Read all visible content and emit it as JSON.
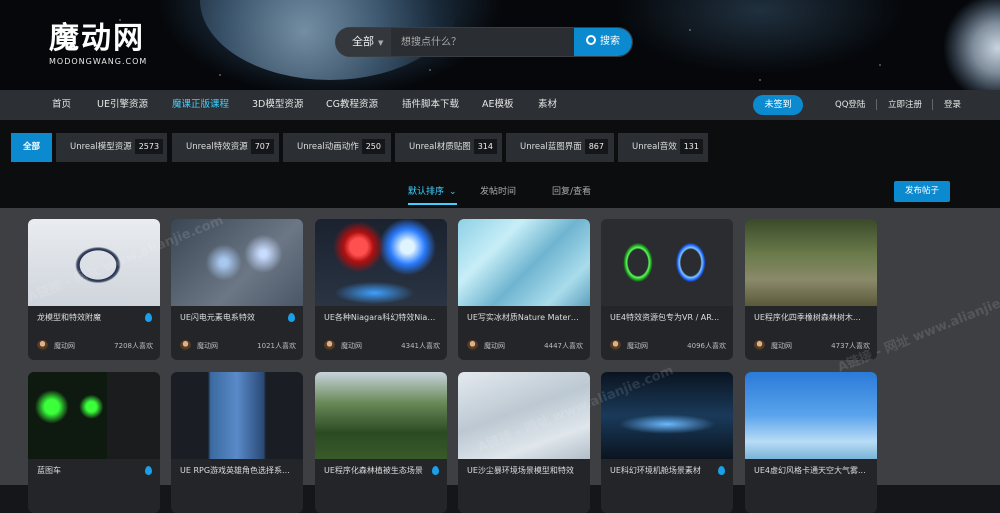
{
  "logo": {
    "main": "魔动网",
    "sub": "MODONGWANG.COM"
  },
  "search": {
    "category": "全部",
    "placeholder": "想搜点什么？",
    "button": "搜索"
  },
  "nav": {
    "items": [
      "首页",
      "UE引擎资源",
      "魔课正版课程",
      "3D模型资源",
      "CG教程资源",
      "插件脚本下载",
      "AE模板",
      "素材"
    ],
    "active_index": 2,
    "checkin": "未签到",
    "qq_login": "QQ登陆",
    "register": "立即注册",
    "login": "登录"
  },
  "categories": [
    {
      "label": "全部",
      "count": null
    },
    {
      "label": "Unreal模型资源",
      "count": "2573"
    },
    {
      "label": "Unreal特效资源",
      "count": "707"
    },
    {
      "label": "Unreal动画动作",
      "count": "250"
    },
    {
      "label": "Unreal材质贴图",
      "count": "314"
    },
    {
      "label": "Unreal蓝图界面",
      "count": "867"
    },
    {
      "label": "Unreal音效",
      "count": "131"
    }
  ],
  "sort": {
    "options": [
      "默认排序",
      "发帖时间",
      "回复/查看"
    ],
    "active": "默认排序",
    "publish": "发布帖子"
  },
  "cards": [
    {
      "title": "龙模型和特效附魔",
      "author": "魔动网",
      "views": "7208人喜欢",
      "hot": true
    },
    {
      "title": "UE闪电元素电系特效",
      "author": "魔动网",
      "views": "1021人喜欢",
      "hot": true
    },
    {
      "title": "UE各种Niagara科幻特效Niag...",
      "author": "魔动网",
      "views": "4341人喜欢",
      "hot": false
    },
    {
      "title": "UE写实冰材质Nature Material...",
      "author": "魔动网",
      "views": "4447人喜欢",
      "hot": false
    },
    {
      "title": "UE4特效资源包专为VR / AR...",
      "author": "魔动网",
      "views": "4096人喜欢",
      "hot": false
    },
    {
      "title": "UE程序化四季橡树森林树木灌...",
      "author": "魔动网",
      "views": "4737人喜欢",
      "hot": false
    },
    {
      "title": "蓝图车",
      "author": "",
      "views": "",
      "hot": true
    },
    {
      "title": "UE RPG游戏英雄角色选择系...",
      "author": "",
      "views": "",
      "hot": false
    },
    {
      "title": "UE程序化森林植被生态场景",
      "author": "",
      "views": "",
      "hot": true
    },
    {
      "title": "UE沙尘暴环境场景模型和特效",
      "author": "",
      "views": "",
      "hot": false
    },
    {
      "title": "UE科幻环境机舱场景素材",
      "author": "",
      "views": "",
      "hot": true
    },
    {
      "title": "UE4虚幻风格卡通天空大气雾...",
      "author": "",
      "views": "",
      "hot": false
    }
  ],
  "watermark": "A链接 - 网址 www.alianjie.com",
  "colors": {
    "accent": "#0b8ad0",
    "active_text": "#3fd0ff",
    "background": "#3d3f42"
  }
}
